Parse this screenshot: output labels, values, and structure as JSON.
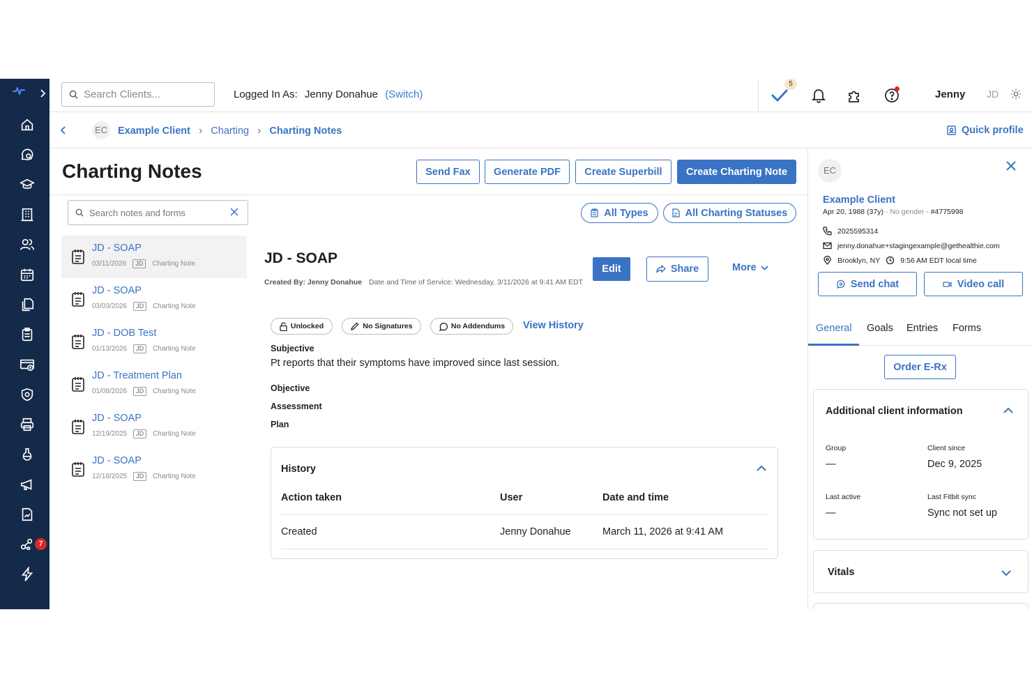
{
  "topbar": {
    "search_placeholder": "Search Clients...",
    "logged_in_label": "Logged In As:",
    "logged_in_name": "Jenny Donahue",
    "switch_label": "(Switch)",
    "tasks_badge": "5",
    "user_name": "Jenny",
    "user_initials": "JD"
  },
  "sidebar": {
    "icons": [
      "home-icon",
      "search-chat-icon",
      "graduation-cap-icon",
      "building-icon",
      "users-icon",
      "calendar-icon",
      "documents-icon",
      "clipboard-icon",
      "billing-icon",
      "shield-icon",
      "printer-icon",
      "lab-flask-icon",
      "megaphone-icon",
      "report-icon",
      "integrations-icon",
      "lightning-icon"
    ],
    "integrations_badge": "7"
  },
  "breadcrumb": {
    "avatar": "EC",
    "items": [
      "Example Client",
      "Charting",
      "Charting Notes"
    ],
    "quick_profile": "Quick profile"
  },
  "page": {
    "title": "Charting Notes",
    "buttons": {
      "send_fax": "Send Fax",
      "generate_pdf": "Generate PDF",
      "create_superbill": "Create Superbill",
      "create_charting_note": "Create Charting Note"
    },
    "note_search_placeholder": "Search notes and forms",
    "filters": {
      "types": "All Types",
      "statuses": "All Charting Statuses"
    }
  },
  "notes": [
    {
      "title": "JD - SOAP",
      "date": "03/11/2026",
      "initials": "JD",
      "kind": "Charting Note"
    },
    {
      "title": "JD - SOAP",
      "date": "03/03/2026",
      "initials": "JD",
      "kind": "Charting Note"
    },
    {
      "title": "JD - DOB Test",
      "date": "01/13/2026",
      "initials": "JD",
      "kind": "Charting Note"
    },
    {
      "title": "JD - Treatment Plan",
      "date": "01/08/2026",
      "initials": "JD",
      "kind": "Charting Note"
    },
    {
      "title": "JD - SOAP",
      "date": "12/19/2025",
      "initials": "JD",
      "kind": "Charting Note"
    },
    {
      "title": "JD - SOAP",
      "date": "12/18/2025",
      "initials": "JD",
      "kind": "Charting Note"
    }
  ],
  "note": {
    "title": "JD - SOAP",
    "created_by": "Created By: Jenny Donahue",
    "service_time": "Date and Time of Service: Wednesday, 3/11/2026 at 9:41 AM EDT",
    "edit": "Edit",
    "share": "Share",
    "more": "More",
    "chips": {
      "lock": "Unlocked",
      "signatures": "No Signatures",
      "addendums": "No Addendums"
    },
    "view_history": "View History",
    "sections": {
      "subjective": "Subjective",
      "subjective_text": "Pt reports that their symptoms have improved since last session.",
      "objective": "Objective",
      "assessment": "Assessment",
      "plan": "Plan"
    },
    "history": {
      "title": "History",
      "columns": [
        "Action taken",
        "User",
        "Date and time"
      ],
      "rows": [
        {
          "action": "Created",
          "user": "Jenny Donahue",
          "datetime": "March 11, 2026 at 9:41 AM"
        }
      ]
    }
  },
  "profile": {
    "avatar": "EC",
    "name": "Example Client",
    "dob": "Apr 20, 1988 (37y)",
    "gender": "No gender",
    "client_id": "#4775998",
    "phone": "2025595314",
    "email": "jenny.donahue+stagingexample@gethealthie.com",
    "location": "Brooklyn, NY",
    "local_time": "9:56 AM EDT local time",
    "send_chat": "Send chat",
    "video_call": "Video call",
    "tabs": [
      "General",
      "Goals",
      "Entries",
      "Forms"
    ],
    "order_erx": "Order E-Rx",
    "additional_info": {
      "title": "Additional client information",
      "group_label": "Group",
      "group_value": "—",
      "client_since_label": "Client since",
      "client_since_value": "Dec 9, 2025",
      "last_active_label": "Last active",
      "last_active_value": "—",
      "fitbit_label": "Last Fitbit sync",
      "fitbit_value": "Sync not set up"
    },
    "vitals_title": "Vitals"
  },
  "colors": {
    "sidebar": "#142a4a",
    "accent": "#3a73c4",
    "badge_red": "#d92828"
  }
}
